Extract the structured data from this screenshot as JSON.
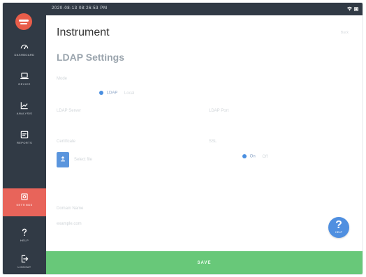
{
  "status_bar": {
    "timestamp": "2020-08-13 08:26:53 PM",
    "wifi_icon": "wifi-icon",
    "battery_icon": "battery-icon"
  },
  "sidebar": {
    "logo_icon": "brand-logo-icon",
    "items": [
      {
        "label": "DASHBOARD",
        "icon": "gauge-icon"
      },
      {
        "label": "DEVICE",
        "icon": "laptop-icon"
      },
      {
        "label": "ANALYSIS",
        "icon": "line-chart-icon"
      },
      {
        "label": "REPORTS",
        "icon": "report-icon"
      },
      {
        "label": "SETTINGS",
        "icon": "settings-icon",
        "active": true
      },
      {
        "label": "HELP",
        "icon": "help-icon"
      },
      {
        "label": "LOGOUT",
        "icon": "logout-icon"
      }
    ]
  },
  "header": {
    "title": "Instrument",
    "top_right": "Back"
  },
  "main": {
    "section_title": "LDAP Settings",
    "mode_label": "Mode",
    "mode_selected": "LDAP",
    "mode_alternate": "Local",
    "field_left_label": "LDAP Server",
    "field_right_label": "LDAP Port",
    "certificate_label": "Certificate",
    "certificate_hint": "Select file",
    "toggle_label": "SSL",
    "toggle_selected": "On",
    "toggle_alternate": "Off",
    "bottom_label": "Domain Name",
    "bottom_value": "example.com",
    "help_label": "HELP"
  },
  "footer": {
    "save_label": "SAVE"
  },
  "colors": {
    "sidebar": "#313a45",
    "accent_active": "#e8645a",
    "blue": "#4f8fe0",
    "green": "#68c879",
    "title": "#333333",
    "section": "#9aa4ad"
  }
}
